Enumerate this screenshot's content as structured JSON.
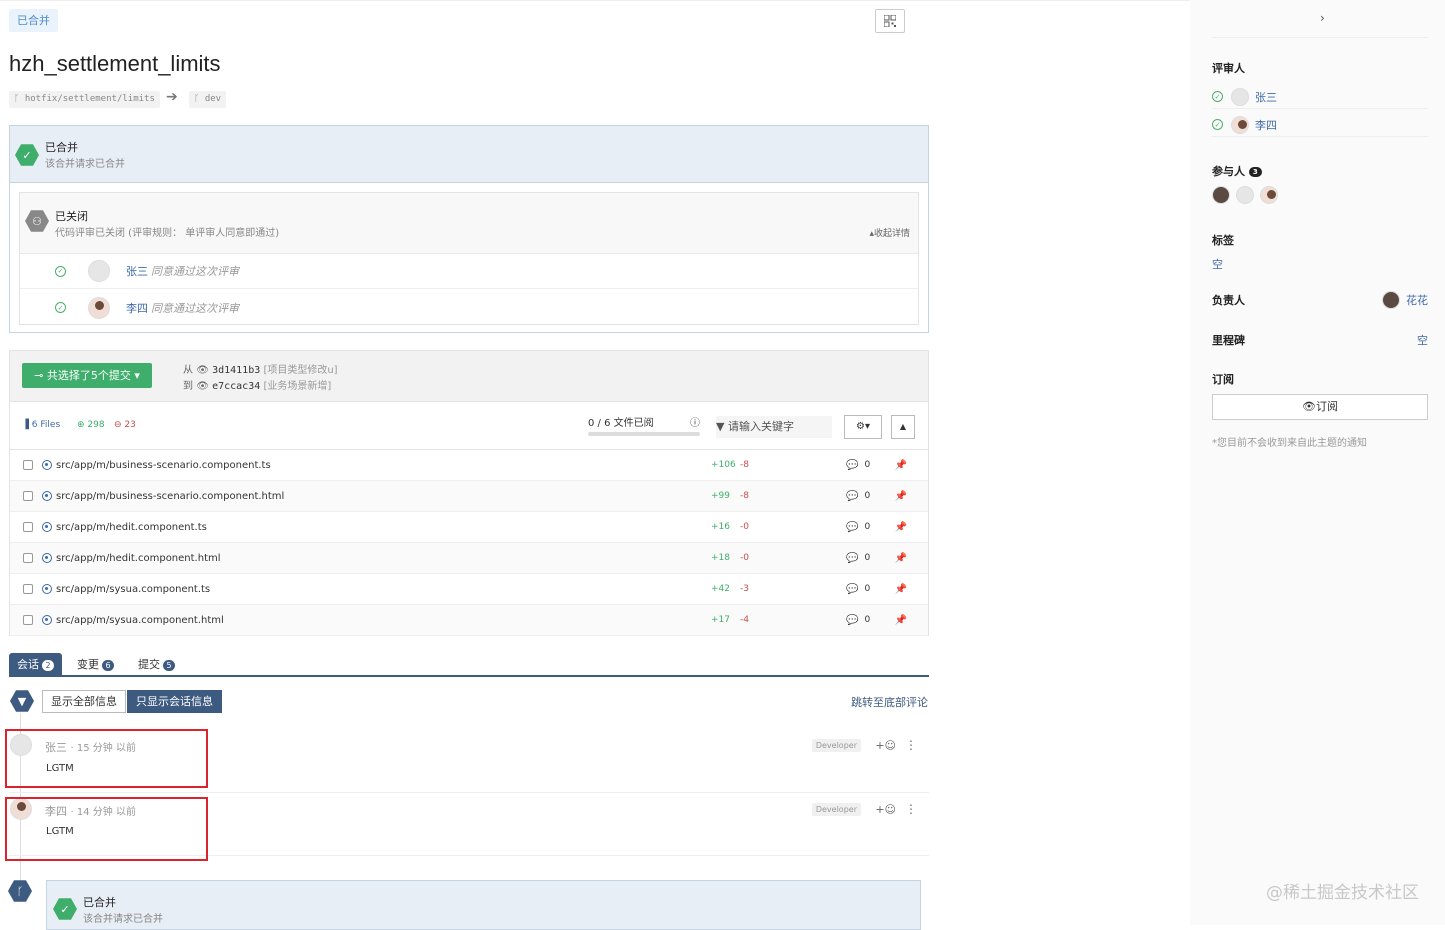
{
  "header": {
    "status_badge": "已合并",
    "title": "hzh_settlement_limits",
    "source_branch": "hotfix/settlement/limits",
    "target_branch": "dev"
  },
  "merged_box": {
    "title": "已合并",
    "subtitle": "该合并请求已合并"
  },
  "review_box": {
    "title": "已关闭",
    "subtitle": "代码评审已关闭 (评审规则： 单评审人同意即通过)",
    "collapse_label": "收起详情",
    "reviewers": [
      {
        "name": "张三",
        "note": "同意通过这次评审"
      },
      {
        "name": "李四",
        "note": "同意通过这次评审"
      }
    ]
  },
  "commits": {
    "select_label": "共选择了5个提交",
    "from_label": "从",
    "from_hash": "3d1411b3",
    "from_msg": "[项目类型修改u]",
    "to_label": "到",
    "to_hash": "e7ccac34",
    "to_msg": "[业务场景新增]"
  },
  "toolbar": {
    "files_count": "6 Files",
    "additions": "298",
    "deletions": "23",
    "viewed": "0 / 6 文件已阅",
    "filter_placeholder": "请输入关键字"
  },
  "files": [
    {
      "path": "src/app/m/business-scenario.component.ts",
      "add": "+106",
      "del": "-8",
      "comments": "0"
    },
    {
      "path": "src/app/m/business-scenario.component.html",
      "add": "+99",
      "del": "-8",
      "comments": "0"
    },
    {
      "path": "src/app/m/hedit.component.ts",
      "add": "+16",
      "del": "-0",
      "comments": "0"
    },
    {
      "path": "src/app/m/hedit.component.html",
      "add": "+18",
      "del": "-0",
      "comments": "0"
    },
    {
      "path": "src/app/m/sysua.component.ts",
      "add": "+42",
      "del": "-3",
      "comments": "0"
    },
    {
      "path": "src/app/m/sysua.component.html",
      "add": "+17",
      "del": "-4",
      "comments": "0"
    }
  ],
  "tabs": [
    {
      "label": "会话",
      "count": "2"
    },
    {
      "label": "变更",
      "count": "6"
    },
    {
      "label": "提交",
      "count": "5"
    }
  ],
  "filter": {
    "show_all": "显示全部信息",
    "show_comments": "只显示会话信息",
    "jump_bottom": "跳转至底部评论"
  },
  "comments": [
    {
      "author": "张三",
      "time": "· 15 分钟 以前",
      "body": "LGTM",
      "role": "Developer"
    },
    {
      "author": "李四",
      "time": "· 14 分钟 以前",
      "body": "LGTM",
      "role": "Developer"
    }
  ],
  "bottom_merged": {
    "title": "已合并",
    "subtitle": "该合并请求已合并"
  },
  "sidebar": {
    "reviewers_label": "评审人",
    "reviewers": [
      "张三",
      "李四"
    ],
    "participants_label": "参与人",
    "participants_count": "3",
    "labels_label": "标签",
    "labels_value": "空",
    "assignee_label": "负责人",
    "assignee": "花花",
    "milestone_label": "里程碑",
    "milestone_value": "空",
    "subscribe_label": "订阅",
    "subscribe_button": "订阅",
    "subscribe_note": "*您目前不会收到来自此主题的通知"
  },
  "watermark": "@稀土掘金技术社区"
}
